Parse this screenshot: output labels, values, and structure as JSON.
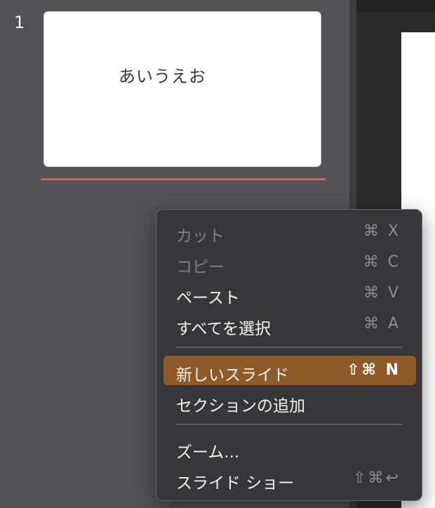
{
  "navigator": {
    "slide_number": "1",
    "slide_text": "あいうえお"
  },
  "context_menu": {
    "items": [
      {
        "label": "カット",
        "shortcut": "⌘ X",
        "enabled": false
      },
      {
        "label": "コピー",
        "shortcut": "⌘ C",
        "enabled": false
      },
      {
        "label": "ペースト",
        "shortcut": "⌘ V",
        "enabled": true
      },
      {
        "label": "すべてを選択",
        "shortcut": "⌘ A",
        "enabled": true
      },
      {
        "label": "新しいスライド",
        "shortcut": "⇧⌘ N",
        "enabled": true,
        "highlighted": true
      },
      {
        "label": "セクションの追加",
        "shortcut": "",
        "enabled": true
      },
      {
        "label": "ズーム...",
        "shortcut": "",
        "enabled": true
      },
      {
        "label": "スライド ショー",
        "shortcut": "⇧⌘↩",
        "enabled": true
      }
    ],
    "highlight_color": "#8e5a2a"
  }
}
